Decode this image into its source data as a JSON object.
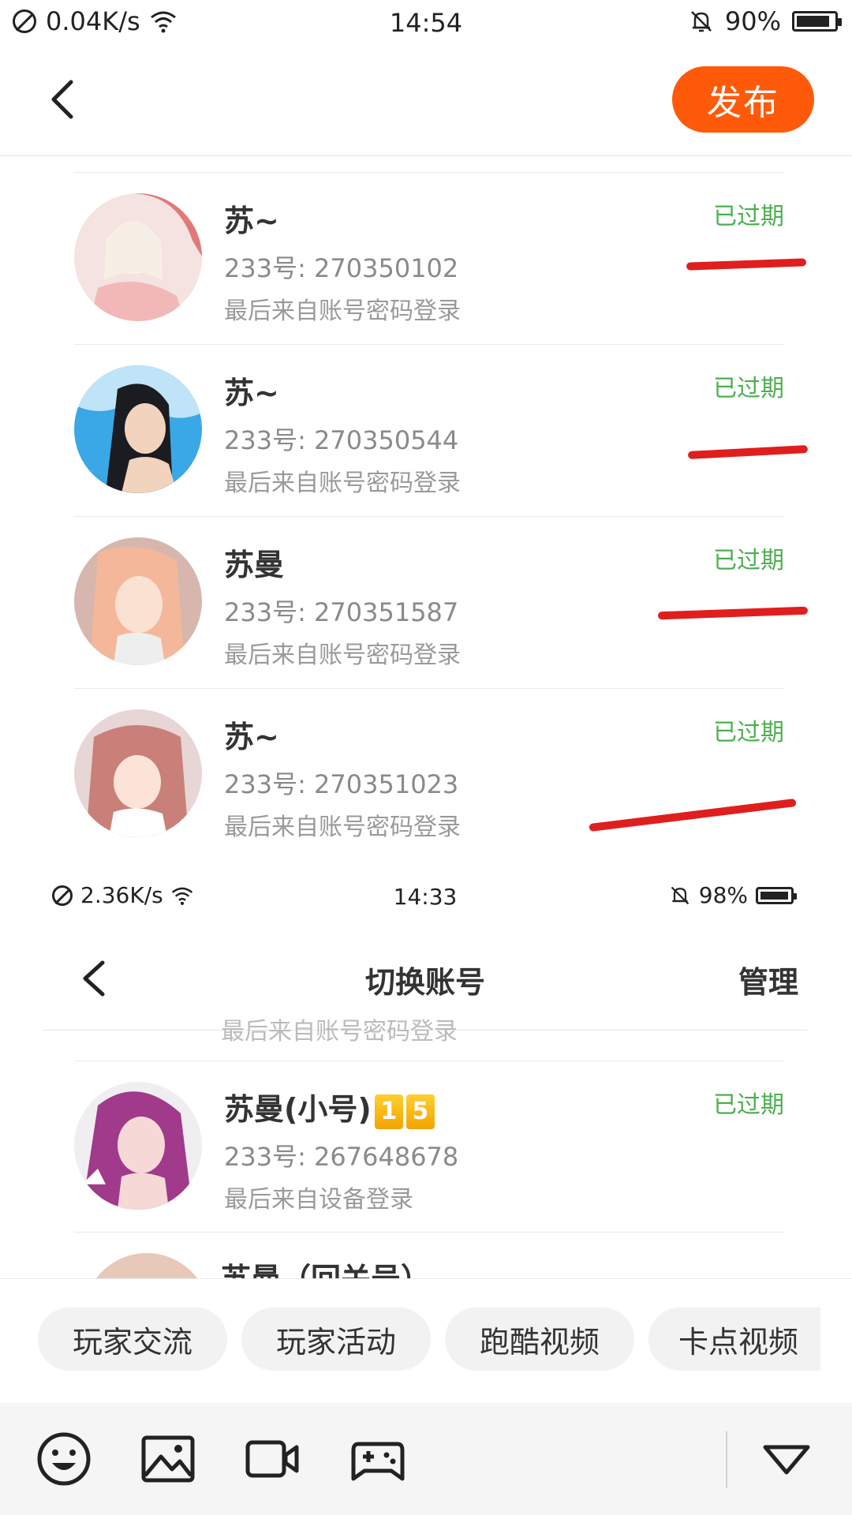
{
  "status_bar": {
    "speed": "0.04K/s",
    "time": "14:54",
    "battery": "90%",
    "battery_level": 0.9
  },
  "header": {
    "publish_label": "发布"
  },
  "accounts": [
    {
      "name": "苏~",
      "id": "233号: 270350102",
      "login": "最后来自账号密码登录",
      "status": "已过期"
    },
    {
      "name": "苏~",
      "id": "233号: 270350544",
      "login": "最后来自账号密码登录",
      "status": "已过期"
    },
    {
      "name": "苏曼",
      "id": "233号: 270351587",
      "login": "最后来自账号密码登录",
      "status": "已过期"
    },
    {
      "name": "苏~",
      "id": "233号: 270351023",
      "login": "最后来自账号密码登录",
      "status": "已过期"
    }
  ],
  "screenshot2": {
    "status_bar": {
      "speed": "2.36K/s",
      "time": "14:33",
      "battery": "98%",
      "battery_level": 0.98
    },
    "title": "切换账号",
    "manage_label": "管理",
    "partial_top_text": "最后来自账号密码登录",
    "account": {
      "name": "苏曼(小号)",
      "badges": [
        "1",
        "5"
      ],
      "id": "233号: 267648678",
      "login": "最后来自设备登录",
      "status": "已过期"
    },
    "partial_bottom_text": "苏曼（回关号）"
  },
  "topics": [
    "玩家交流",
    "玩家活动",
    "跑酷视频",
    "卡点视频"
  ],
  "toolbar": {
    "icons": [
      "emoji-icon",
      "image-icon",
      "video-icon",
      "gamepad-icon",
      "collapse-icon"
    ]
  },
  "colors": {
    "accent": "#ff5a0a",
    "expired": "#4caf50",
    "annotation": "#e01e1e"
  }
}
